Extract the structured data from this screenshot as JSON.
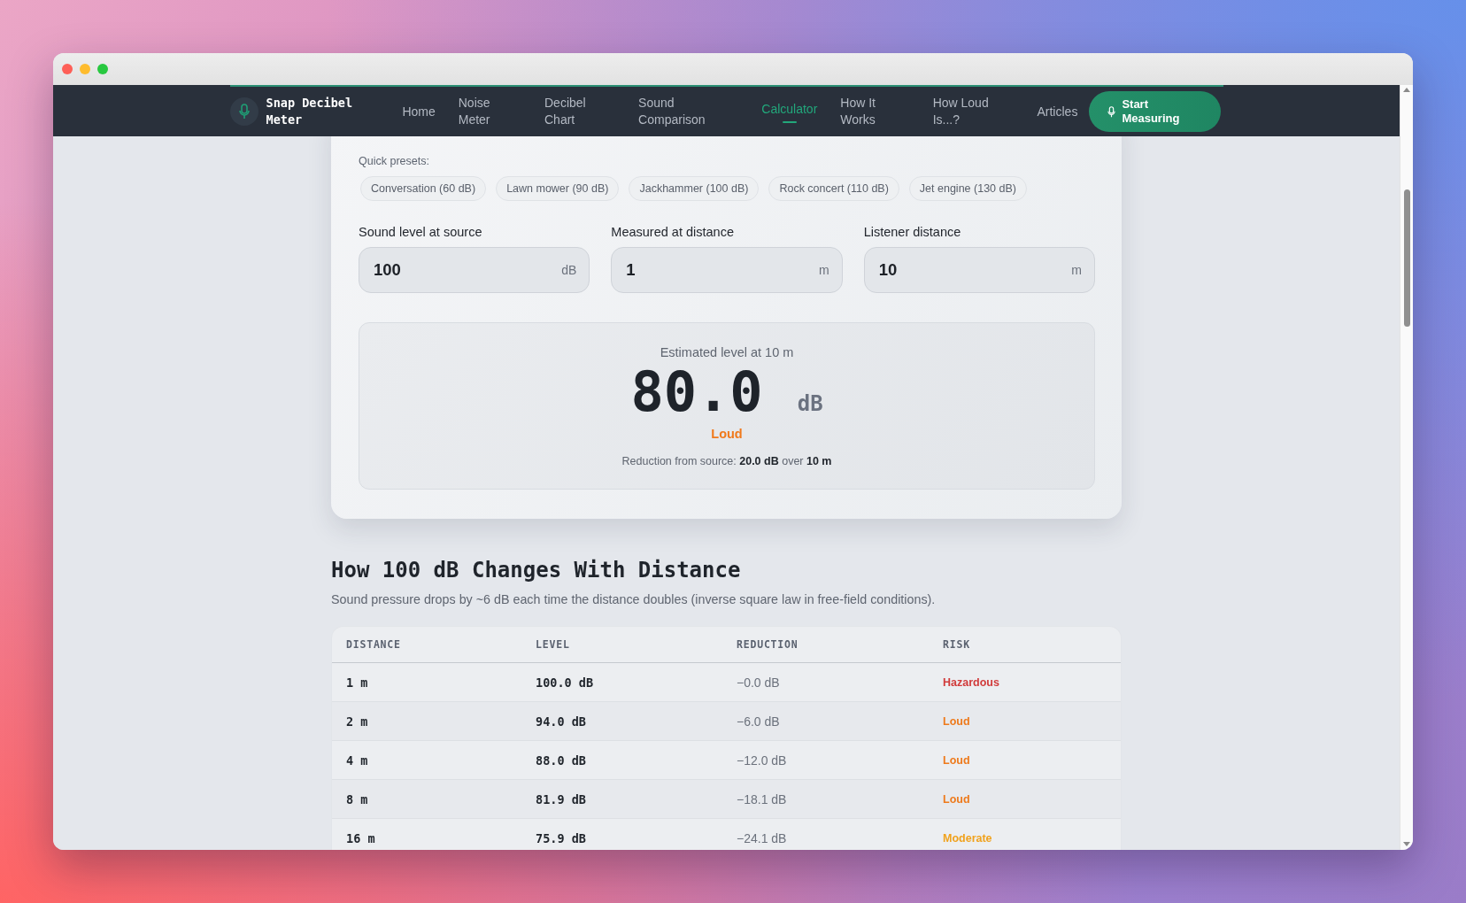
{
  "nav": {
    "brand": "Snap Decibel Meter",
    "links": [
      {
        "label": "Home",
        "selected": false
      },
      {
        "label": "Noise Meter",
        "selected": false
      },
      {
        "label": "Decibel Chart",
        "selected": false
      },
      {
        "label": "Sound Comparison",
        "selected": false
      },
      {
        "label": "Calculator",
        "selected": true
      },
      {
        "label": "How It Works",
        "selected": false
      },
      {
        "label": "How Loud Is...?",
        "selected": false
      },
      {
        "label": "Articles",
        "selected": false
      }
    ],
    "cta": "Start Measuring"
  },
  "calculator": {
    "presets_label": "Quick presets:",
    "presets": [
      "Conversation (60 dB)",
      "Lawn mower (90 dB)",
      "Jackhammer (100 dB)",
      "Rock concert (110 dB)",
      "Jet engine (130 dB)"
    ],
    "fields": [
      {
        "label": "Sound level at source",
        "value": "100",
        "unit": "dB"
      },
      {
        "label": "Measured at distance",
        "value": "1",
        "unit": "m"
      },
      {
        "label": "Listener distance",
        "value": "10",
        "unit": "m"
      }
    ],
    "result": {
      "caption": "Estimated level at 10 m",
      "value": "80.0",
      "unit": "dB",
      "category": "Loud",
      "note": "Reduction from source: **20.0 dB** over **10 m**"
    }
  },
  "distance_table": {
    "title": "How 100 dB Changes With Distance",
    "description": "Sound pressure drops by ~6 dB each time the distance doubles (inverse square law in free-field conditions).",
    "columns": [
      "DISTANCE",
      "LEVEL",
      "REDUCTION",
      "RISK"
    ],
    "rows": [
      {
        "cells": [
          "1 m",
          "100.0 dB",
          "−0.0 dB",
          "Hazardous"
        ],
        "color": "#d13b3b"
      },
      {
        "cells": [
          "2 m",
          "94.0 dB",
          "−6.0 dB",
          "Loud"
        ],
        "color": "#ee7a1c"
      },
      {
        "cells": [
          "4 m",
          "88.0 dB",
          "−12.0 dB",
          "Loud"
        ],
        "color": "#ee7a1c"
      },
      {
        "cells": [
          "8 m",
          "81.9 dB",
          "−18.1 dB",
          "Loud"
        ],
        "color": "#ee7a1c"
      },
      {
        "cells": [
          "16 m",
          "75.9 dB",
          "−24.1 dB",
          "Moderate"
        ],
        "color": "#f0a21d"
      }
    ]
  }
}
